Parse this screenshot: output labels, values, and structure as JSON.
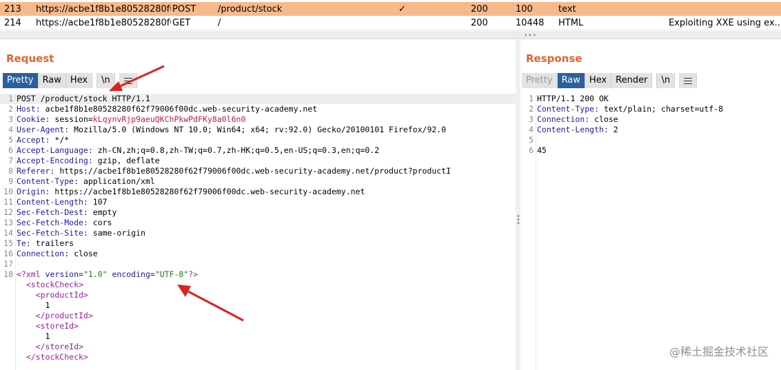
{
  "history": {
    "rows": [
      {
        "num": "213",
        "host": "https://acbe1f8b1e80528280f6...",
        "method": "POST",
        "url": "/product/stock",
        "check": "✓",
        "status": "200",
        "length": "100",
        "mime": "text",
        "title": ""
      },
      {
        "num": "214",
        "host": "https://acbe1f8b1e80528280f6...",
        "method": "GET",
        "url": "/",
        "check": "",
        "status": "200",
        "length": "10448",
        "mime": "HTML",
        "title": "Exploiting XXE using ex..."
      }
    ]
  },
  "request": {
    "title": "Request",
    "tabs": {
      "pretty": "Pretty",
      "raw": "Raw",
      "hex": "Hex",
      "newline": "\\n"
    },
    "lines": [
      {
        "n": "1",
        "key": "",
        "val": "POST /product/stock HTTP/1.1"
      },
      {
        "n": "2",
        "key": "Host:",
        "val": " acbe1f8b1e80528280f62f79006f00dc.web-security-academy.net"
      },
      {
        "n": "3",
        "key": "Cookie:",
        "val": " session=",
        "red": "kLqynvRjp9aeuQKChPkwPdFKy8a0l6n0"
      },
      {
        "n": "4",
        "key": "User-Agent:",
        "val": " Mozilla/5.0 (Windows NT 10.0; Win64; x64; rv:92.0) Gecko/20100101 Firefox/92.0"
      },
      {
        "n": "5",
        "key": "Accept:",
        "val": " */*"
      },
      {
        "n": "6",
        "key": "Accept-Language:",
        "val": " zh-CN,zh;q=0.8,zh-TW;q=0.7,zh-HK;q=0.5,en-US;q=0.3,en;q=0.2"
      },
      {
        "n": "7",
        "key": "Accept-Encoding:",
        "val": " gzip, deflate"
      },
      {
        "n": "8",
        "key": "Referer:",
        "val": " https://acbe1f8b1e80528280f62f79006f00dc.web-security-academy.net/product?productI"
      },
      {
        "n": "9",
        "key": "Content-Type:",
        "val": " application/xml"
      },
      {
        "n": "10",
        "key": "Origin:",
        "val": " https://acbe1f8b1e80528280f62f79006f00dc.web-security-academy.net"
      },
      {
        "n": "11",
        "key": "Content-Length:",
        "val": " 107"
      },
      {
        "n": "12",
        "key": "Sec-Fetch-Dest:",
        "val": " empty"
      },
      {
        "n": "13",
        "key": "Sec-Fetch-Mode:",
        "val": " cors"
      },
      {
        "n": "14",
        "key": "Sec-Fetch-Site:",
        "val": " same-origin"
      },
      {
        "n": "15",
        "key": "Te:",
        "val": " trailers"
      },
      {
        "n": "16",
        "key": "Connection:",
        "val": " close"
      },
      {
        "n": "17",
        "key": "",
        "val": ""
      }
    ],
    "xml": {
      "n": "18",
      "decl_open": "<?xml",
      "version_attr": " version=",
      "version_val": "\"1.0\"",
      "enc_attr": " encoding=",
      "enc_val": "\"UTF-8\"",
      "decl_close": "?>",
      "stock_open": "  <stockCheck>",
      "pid_open": "    <productId>",
      "pid_val": "      1",
      "pid_close": "    </productId>",
      "sid_open": "    <storeId>",
      "sid_val": "      1",
      "sid_close": "    </storeId>",
      "stock_close": "  </stockCheck>"
    }
  },
  "response": {
    "title": "Response",
    "tabs": {
      "pretty": "Pretty",
      "raw": "Raw",
      "hex": "Hex",
      "render": "Render",
      "newline": "\\n"
    },
    "lines": [
      {
        "n": "1",
        "key": "",
        "val": "HTTP/1.1 200 OK"
      },
      {
        "n": "2",
        "key": "Content-Type:",
        "val": " text/plain; charset=utf-8"
      },
      {
        "n": "3",
        "key": "Connection:",
        "val": " close"
      },
      {
        "n": "4",
        "key": "Content-Length:",
        "val": " 2"
      },
      {
        "n": "5",
        "key": "",
        "val": ""
      },
      {
        "n": "6",
        "key": "",
        "val": "45"
      }
    ]
  },
  "watermark": "@稀土掘金技术社区",
  "colors": {
    "accent": "#e8602c",
    "selected_row": "#f7b98a",
    "active_tab": "#2c5f9e",
    "arrow": "#e02020"
  }
}
